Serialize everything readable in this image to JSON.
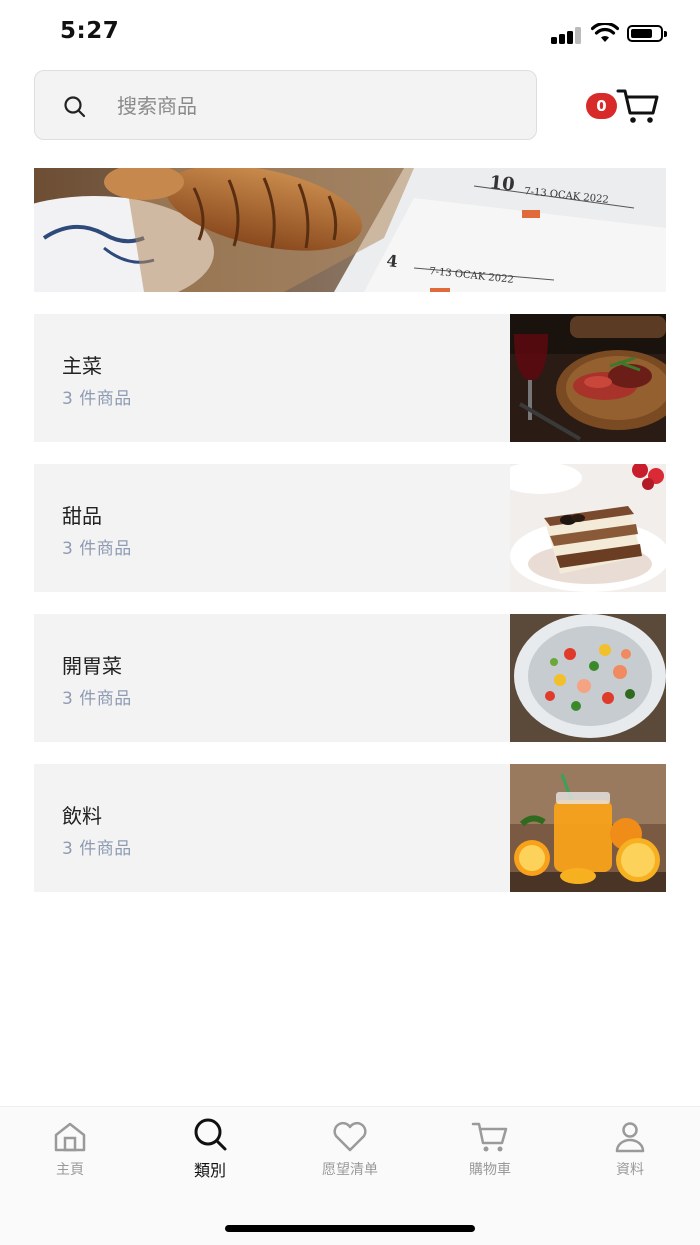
{
  "status_bar": {
    "time": "5:27"
  },
  "search": {
    "placeholder": "搜索商品",
    "value": ""
  },
  "cart": {
    "count": "0"
  },
  "categories": [
    {
      "name": "主菜",
      "count": "3 件商品",
      "image": "steak-photo"
    },
    {
      "name": "甜品",
      "count": "3 件商品",
      "image": "tiramisu-photo"
    },
    {
      "name": "開胃菜",
      "count": "3 件商品",
      "image": "salad-photo"
    },
    {
      "name": "飲料",
      "count": "3 件商品",
      "image": "orange-juice-photo"
    }
  ],
  "banner": {
    "texts": [
      "10",
      "7-13 OCAK 2022",
      "4",
      "7-13 OCAK 2022"
    ]
  },
  "nav": {
    "items": [
      {
        "label": "主頁",
        "icon": "home-icon"
      },
      {
        "label": "類別",
        "icon": "search-icon"
      },
      {
        "label": "愿望清单",
        "icon": "heart-icon"
      },
      {
        "label": "購物車",
        "icon": "cart-icon"
      },
      {
        "label": "資料",
        "icon": "user-icon"
      }
    ],
    "active": "類別"
  },
  "colors": {
    "badge": "#d92a2a",
    "card_bg": "#f3f3f3",
    "count_text": "#8f9bb3",
    "inactive_nav": "#9a9a9a"
  }
}
